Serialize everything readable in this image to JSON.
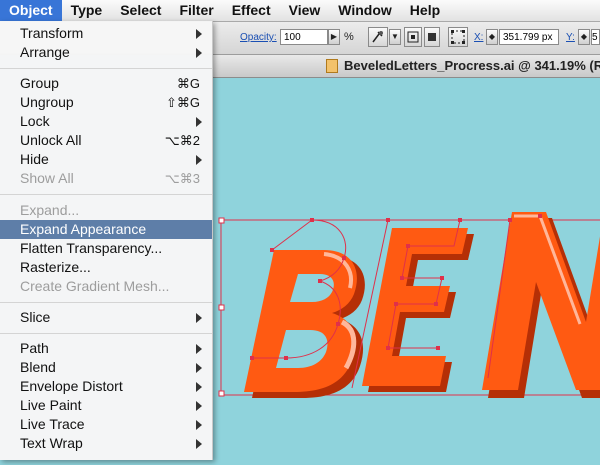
{
  "menubar": {
    "items": [
      "Object",
      "Type",
      "Select",
      "Filter",
      "Effect",
      "View",
      "Window",
      "Help"
    ],
    "active": "Object"
  },
  "controlbar": {
    "opacity_label": "Opacity:",
    "opacity_value": "100",
    "opacity_unit": "%",
    "x_label": "X:",
    "x_value": "351.799 px",
    "y_label": "Y:",
    "y_value": "5"
  },
  "document": {
    "title": "BeveledLetters_Procress.ai @ 341.19% (R"
  },
  "menu": {
    "items": [
      {
        "label": "Transform",
        "submenu": true
      },
      {
        "label": "Arrange",
        "submenu": true
      },
      {
        "label": "Group",
        "shortcut": "⌘G"
      },
      {
        "label": "Ungroup",
        "shortcut": "⇧⌘G"
      },
      {
        "label": "Lock",
        "submenu": true
      },
      {
        "label": "Unlock All",
        "shortcut": "⌥⌘2"
      },
      {
        "label": "Hide",
        "submenu": true
      },
      {
        "label": "Show All",
        "shortcut": "⌥⌘3",
        "disabled": true
      },
      {
        "label": "Expand...",
        "disabled": true
      },
      {
        "label": "Expand Appearance",
        "highlighted": true
      },
      {
        "label": "Flatten Transparency..."
      },
      {
        "label": "Rasterize..."
      },
      {
        "label": "Create Gradient Mesh...",
        "disabled": true
      },
      {
        "label": "Slice",
        "submenu": true
      },
      {
        "label": "Path",
        "submenu": true
      },
      {
        "label": "Blend",
        "submenu": true
      },
      {
        "label": "Envelope Distort",
        "submenu": true
      },
      {
        "label": "Live Paint",
        "submenu": true
      },
      {
        "label": "Live Trace",
        "submenu": true
      },
      {
        "label": "Text Wrap",
        "submenu": true
      }
    ]
  },
  "artwork": {
    "text": "BEN",
    "fill_color": "#ff5a12",
    "bevel_dark": "#b52f06",
    "selection_color": "#e0304a",
    "canvas_color": "#8fd3dc",
    "highlight_color": "#5e7ea8"
  }
}
